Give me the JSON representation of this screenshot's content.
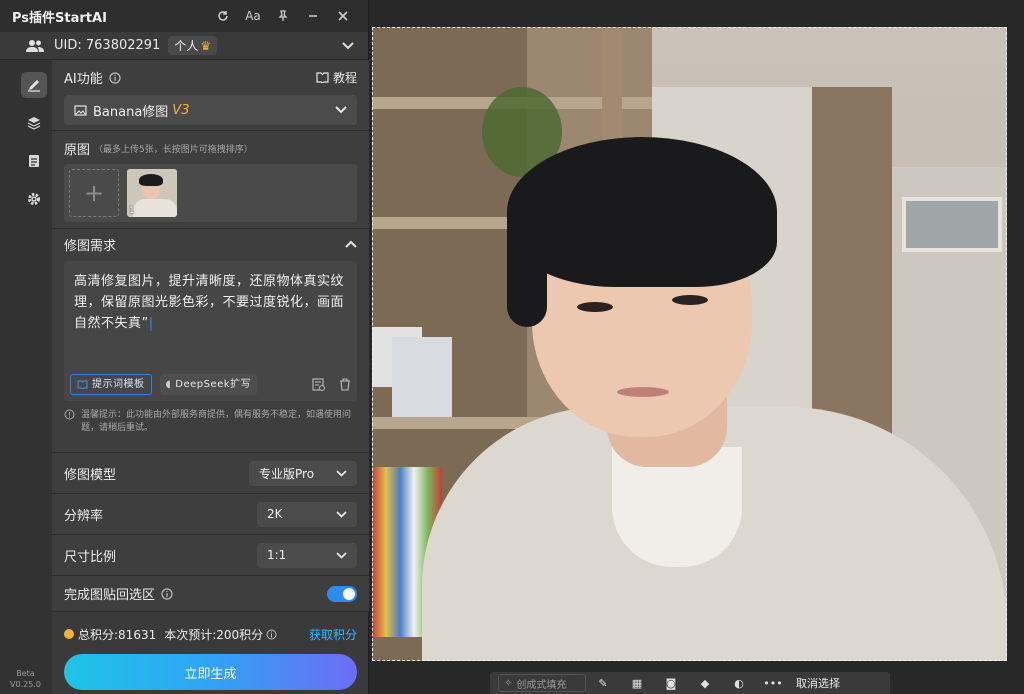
{
  "window": {
    "title": "Ps插件StartAI"
  },
  "user": {
    "uid_label": "UID:",
    "uid": "763802291",
    "tier": "个人"
  },
  "ai_function": {
    "label": "AI功能",
    "tutorial": "教程",
    "model_name": "Banana修图",
    "model_badge": "V3"
  },
  "original": {
    "label": "原图",
    "hint": "（最多上传5张，长按图片可拖拽排序）",
    "thumb_index": "1"
  },
  "requirement": {
    "label": "修图需求",
    "text": "高清修复图片，提升清晰度，还原物体真实纹理，保留原图光影色彩，不要过度锐化，画面自然不失真”",
    "template_btn": "提示词模板",
    "deepseek_btn": "DeepSeek扩写",
    "tip": "温馨提示：此功能由外部服务商提供，偶有服务不稳定，如遇使用问题，请稍后重试。"
  },
  "options": {
    "model": {
      "label": "修图模型",
      "value": "专业版Pro"
    },
    "resolution": {
      "label": "分辨率",
      "value": "2K"
    },
    "ratio": {
      "label": "尺寸比例",
      "value": "1:1"
    },
    "paste_back": {
      "label": "完成图贴回选区",
      "enabled": true
    }
  },
  "footer": {
    "total_points": "总积分:81631",
    "estimate": "本次预计:200积分",
    "get_points": "获取积分",
    "generate": "立即生成"
  },
  "version": {
    "line1": "Beta",
    "line2": "V0.25.0"
  },
  "context_bar": {
    "fill_placeholder": "创成式填充",
    "deselect": "取消选择"
  },
  "colors": {
    "accent": "#2e8cf0",
    "badge": "#f2b33d",
    "link": "#38b6ff"
  }
}
